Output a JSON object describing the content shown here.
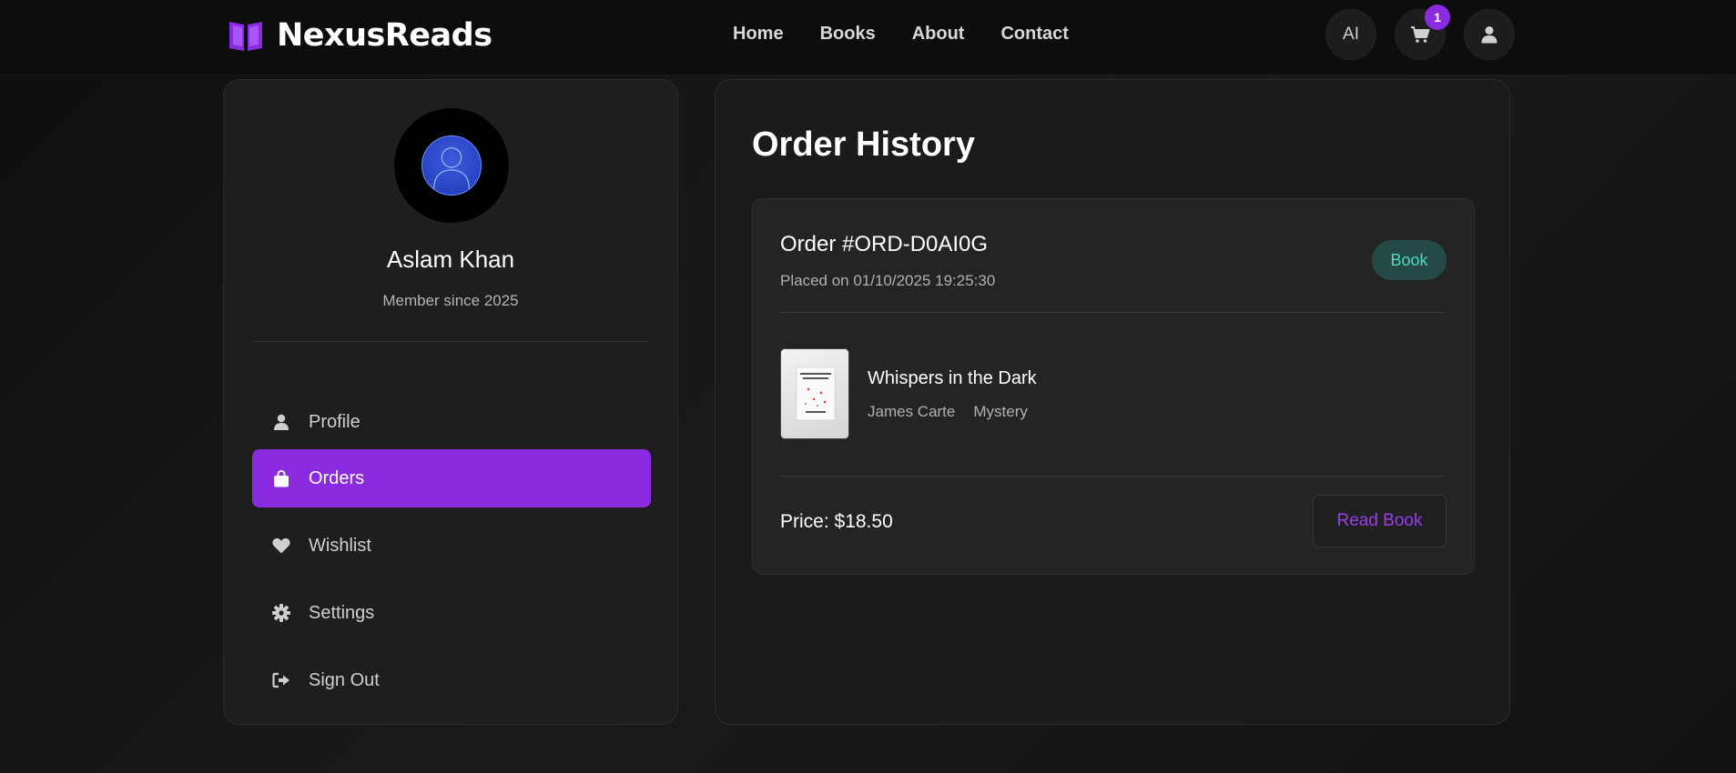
{
  "navbar": {
    "brand_name": "NexusReads",
    "links": [
      "Home",
      "Books",
      "About",
      "Contact"
    ],
    "ai_label": "AI",
    "cart_count": "1",
    "icons": {
      "logo": "open-book-icon",
      "cart": "cart-icon",
      "user": "user-icon"
    },
    "accent_color": "#8a2be2"
  },
  "sidebar": {
    "user_name": "Aslam Khan",
    "member_since": "Member since 2025",
    "items": [
      {
        "label": "Profile",
        "icon": "user-icon",
        "active": false
      },
      {
        "label": "Orders",
        "icon": "shopping-bag-icon",
        "active": true
      },
      {
        "label": "Wishlist",
        "icon": "heart-icon",
        "active": false
      },
      {
        "label": "Settings",
        "icon": "gear-icon",
        "active": false
      },
      {
        "label": "Sign Out",
        "icon": "sign-out-icon",
        "active": false
      }
    ]
  },
  "main": {
    "title": "Order History",
    "orders": [
      {
        "order_id": "Order #ORD-D0AI0G",
        "placed_on": "Placed on 01/10/2025 19:25:30",
        "type": "Book",
        "book": {
          "title": "Whispers in the Dark",
          "author": "James Carte",
          "genre": "Mystery"
        },
        "price": "Price: $18.50",
        "action_label": "Read Book"
      }
    ]
  }
}
